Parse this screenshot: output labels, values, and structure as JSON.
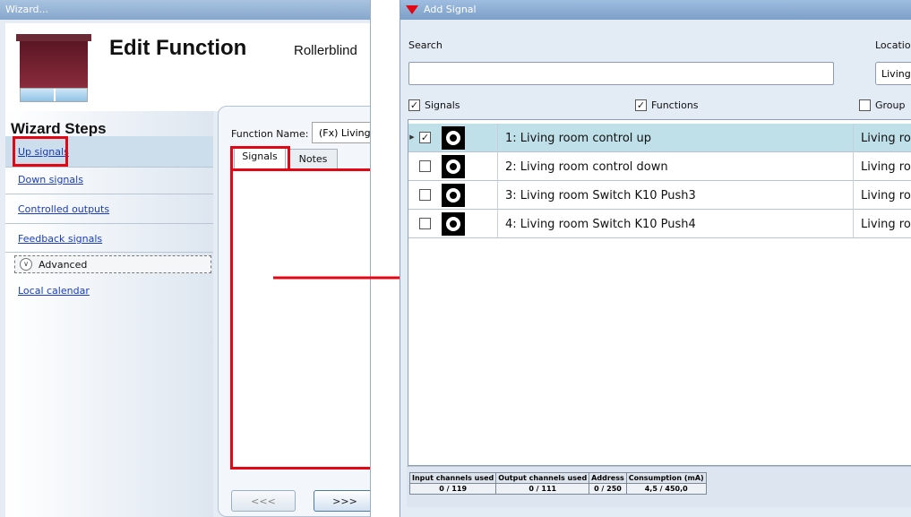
{
  "wizard": {
    "title": "Wizard...",
    "header_title": "Edit Function",
    "header_subtitle": "Rollerblind",
    "steps_title": "Wizard Steps",
    "steps": [
      {
        "label": "Up signals"
      },
      {
        "label": "Down signals"
      },
      {
        "label": "Controlled outputs"
      },
      {
        "label": "Feedback signals"
      }
    ],
    "advanced_label": "Advanced",
    "extra_step": "Local calendar",
    "function_name_label": "Function Name:",
    "function_name_value": "(Fx) Living",
    "tabs": [
      {
        "label": "Signals"
      },
      {
        "label": "Notes"
      }
    ],
    "prev_button": "<<<",
    "next_button": ">>>"
  },
  "add_signal": {
    "title": "Add Signal",
    "search_label": "Search",
    "location_label": "Location",
    "location_value": "Living",
    "filter_signals": "Signals",
    "filter_functions": "Functions",
    "filter_group": "Group",
    "rows": [
      {
        "name": "1: Living room control up",
        "location": "Living ro",
        "checked": true
      },
      {
        "name": "2: Living room control down",
        "location": "Living ro",
        "checked": false
      },
      {
        "name": "3: Living room Switch K10 Push3",
        "location": "Living ro",
        "checked": false
      },
      {
        "name": "4: Living room Switch K10 Push4",
        "location": "Living ro",
        "checked": false
      }
    ],
    "status": {
      "headers": [
        "Input channels used",
        "Output channels used",
        "Address",
        "Consumption (mA)"
      ],
      "values": [
        "0 / 119",
        "0 / 111",
        "0 / 250",
        "4,5 / 450,0"
      ]
    }
  },
  "colors": {
    "highlight": "#e30613",
    "selected_row": "#bfdfe9",
    "link": "#1a3cc0"
  }
}
